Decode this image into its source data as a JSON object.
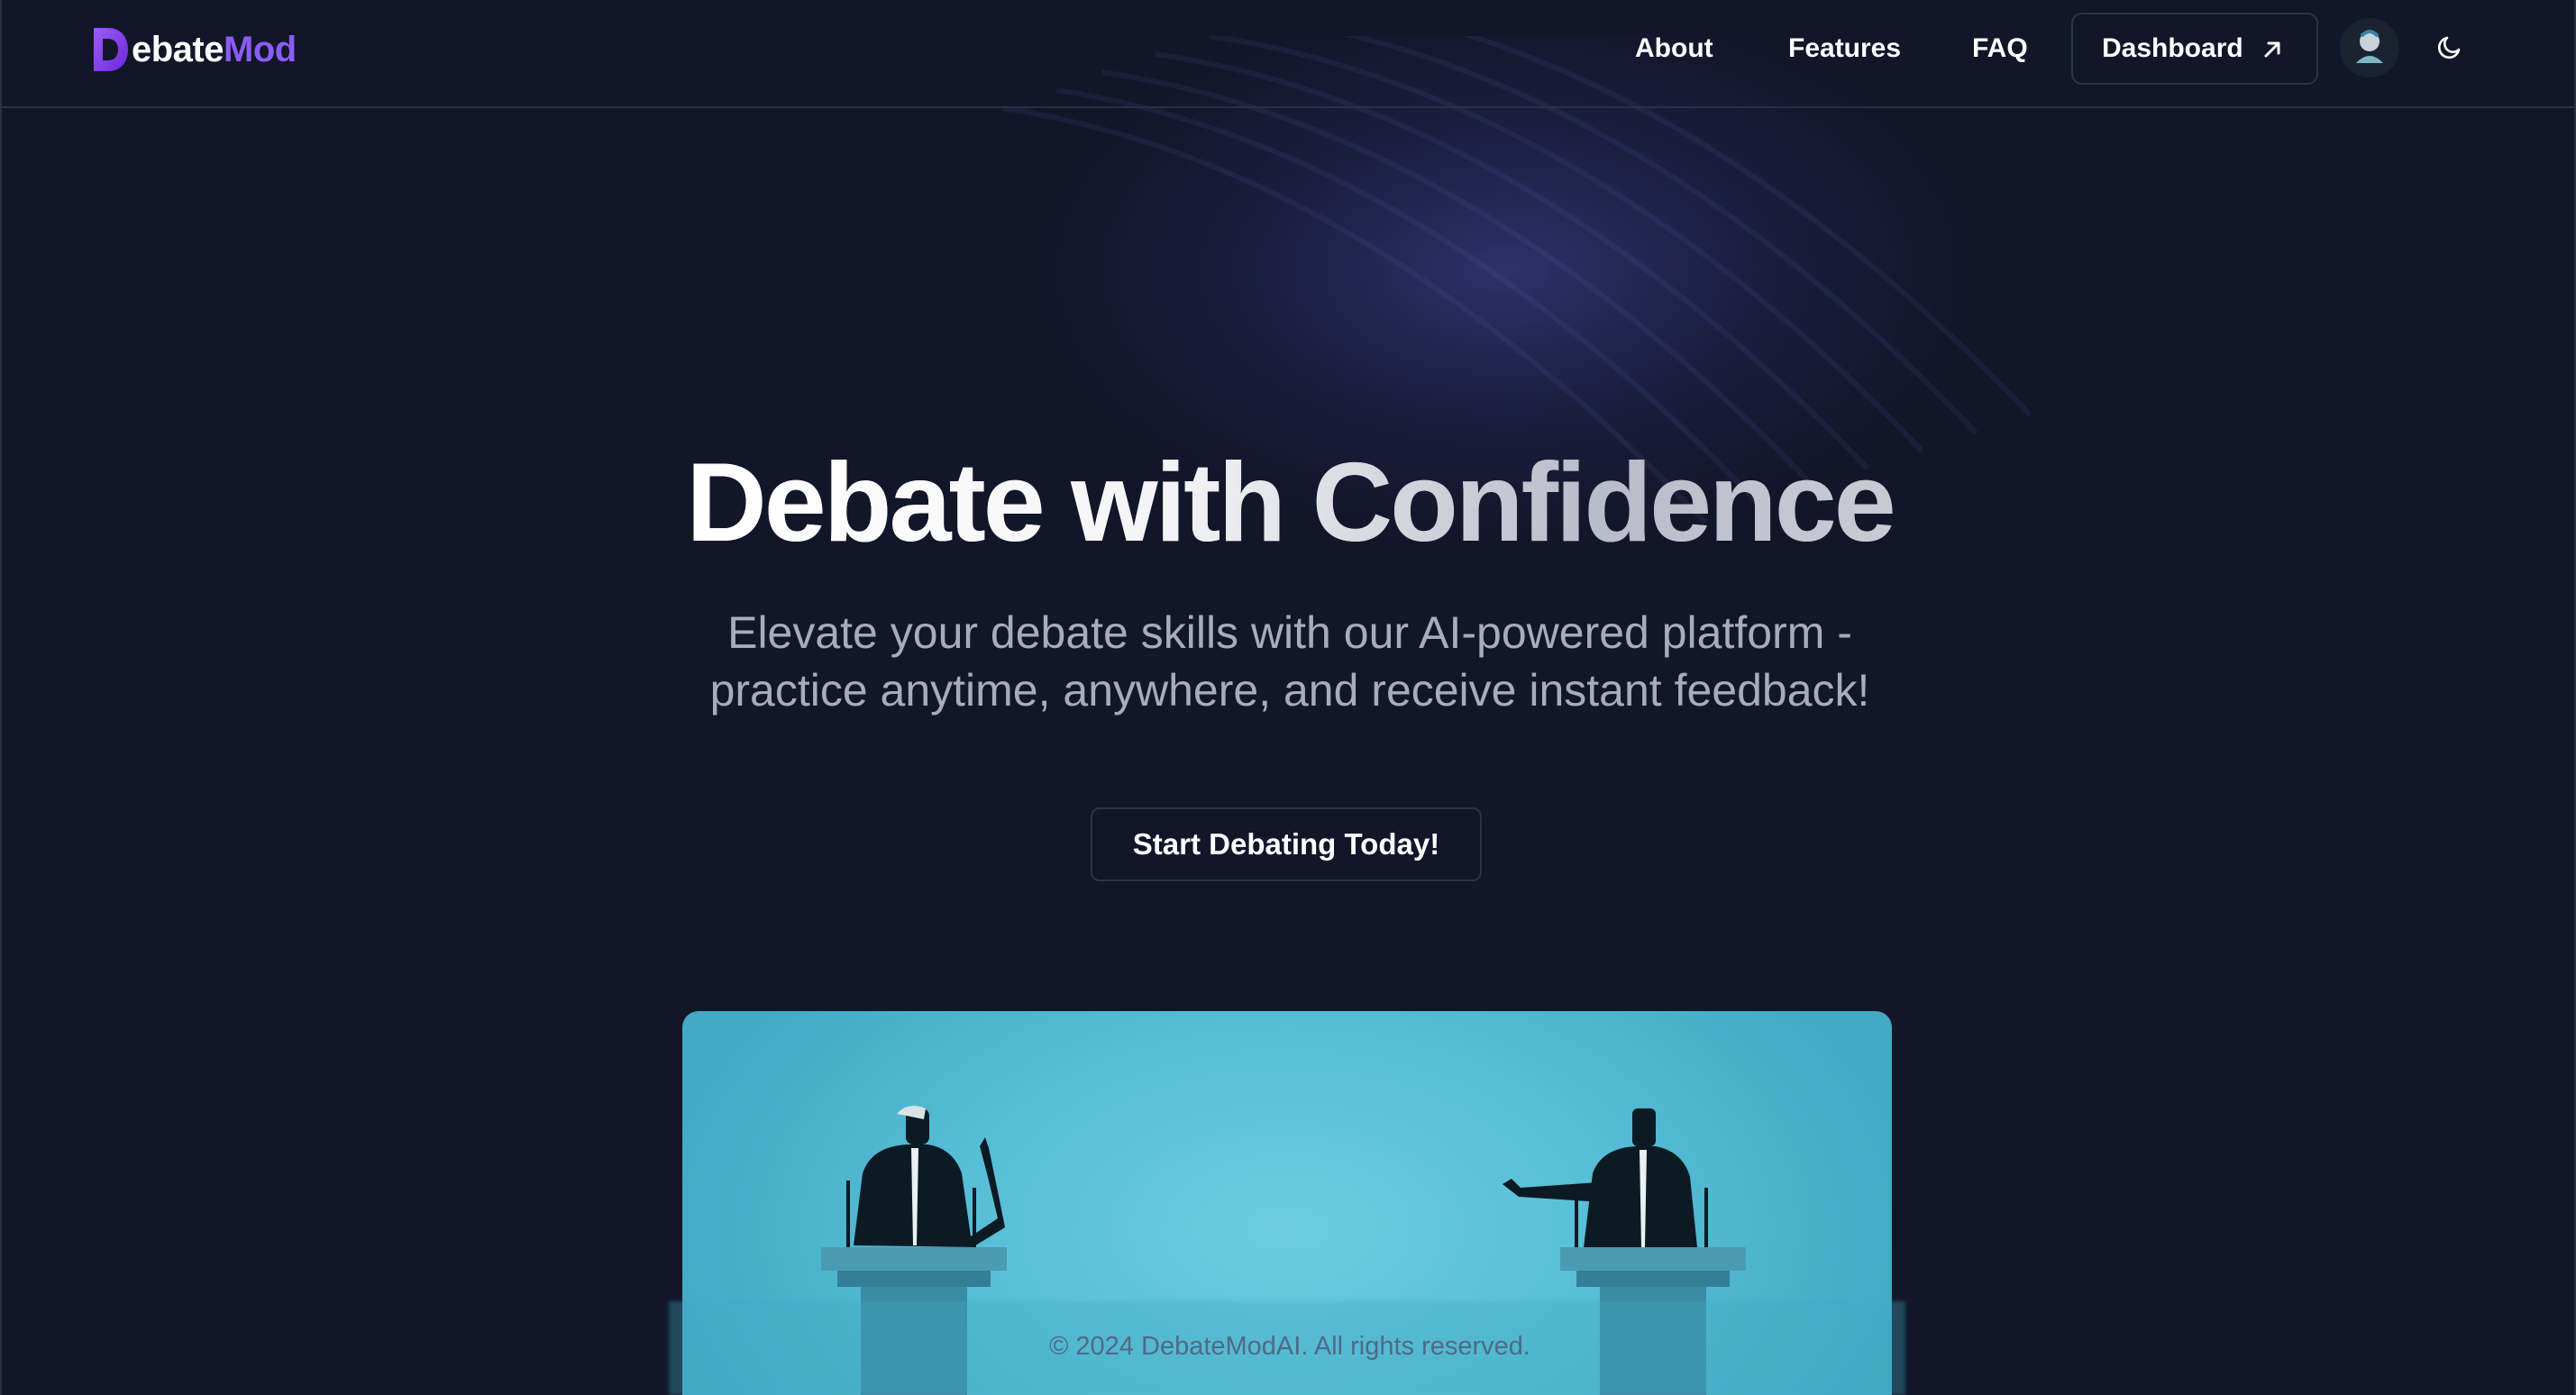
{
  "brand": {
    "logo_letter": "D",
    "name_white": "ebate",
    "name_purple": "Mod",
    "accent_color": "#8b5cf6"
  },
  "nav": {
    "links": [
      "About",
      "Features",
      "FAQ"
    ],
    "dashboard_label": "Dashboard",
    "dashboard_icon": "arrow-up-right-icon",
    "avatar_icon": "user-avatar",
    "theme_icon": "moon-icon"
  },
  "hero": {
    "title": "Debate with Confidence",
    "subtitle_line1": "Elevate your debate skills with our AI-powered platform -",
    "subtitle_line2": "practice anytime, anywhere, and receive instant feedback!",
    "cta_label": "Start Debating Today!",
    "image": "two-debaters-at-podiums-illustration"
  },
  "footer": {
    "copyright": "© 2024 DebateModAI. All rights reserved."
  },
  "colors": {
    "background": "#121629",
    "border": "#2a2f45",
    "subtitle": "#a7abbd",
    "image_bg": "#55bdd5"
  }
}
